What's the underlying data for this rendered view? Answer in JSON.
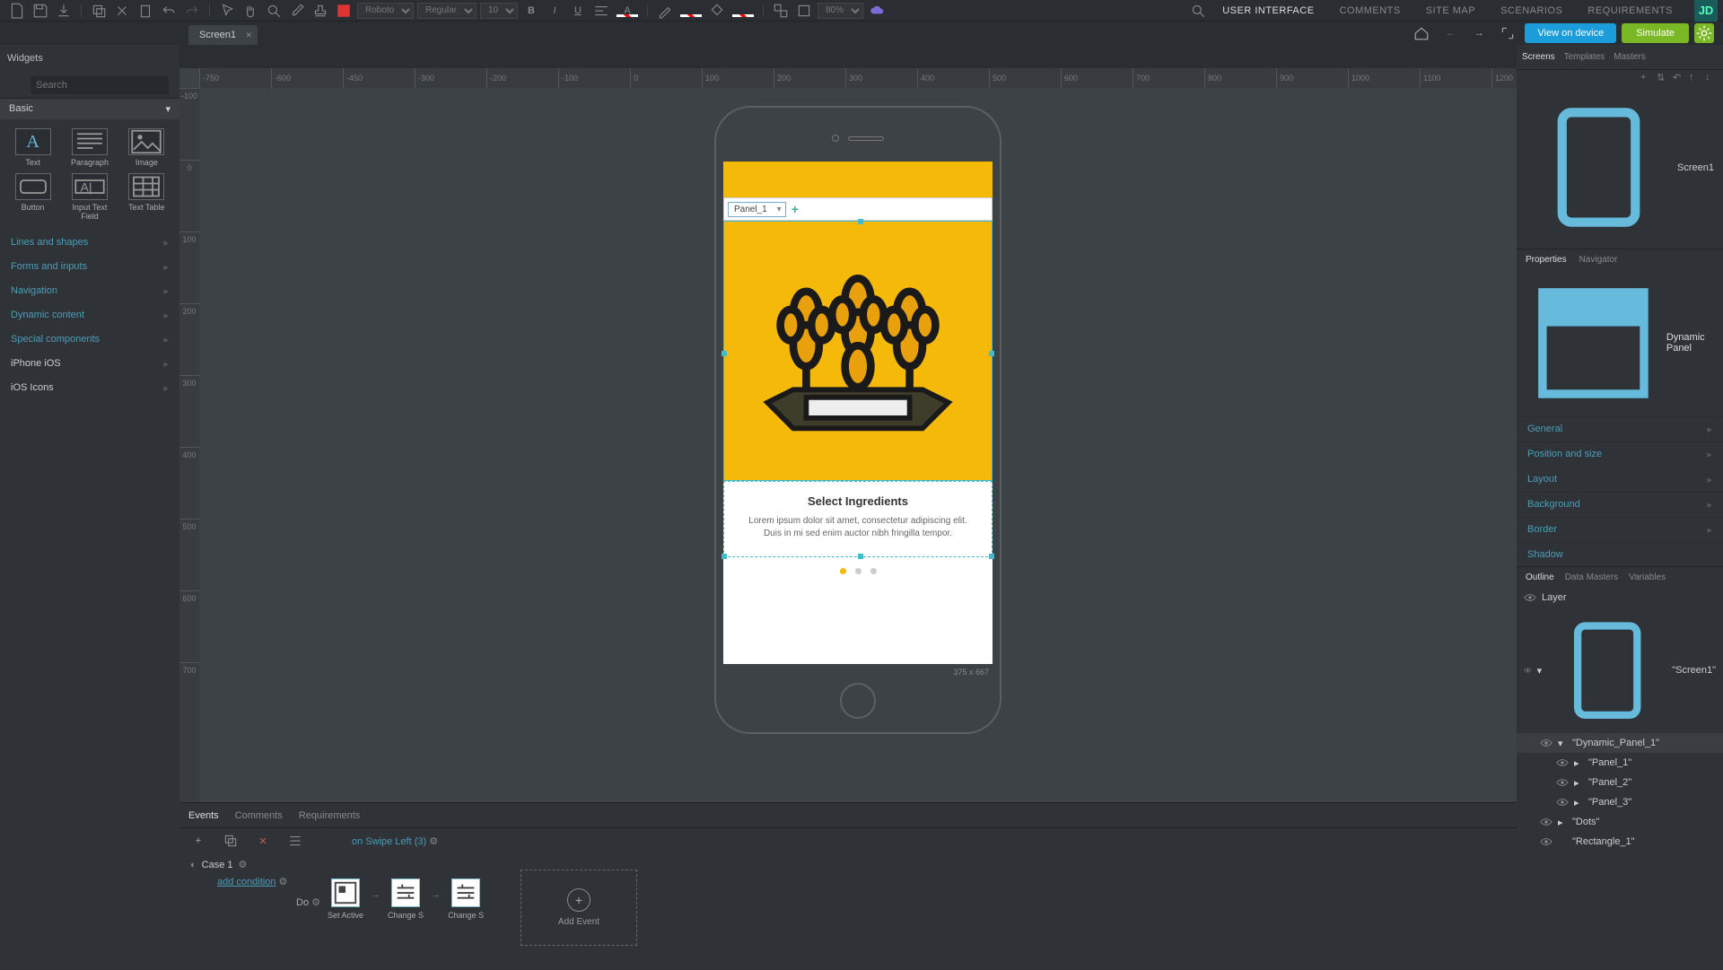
{
  "toolbar": {
    "font": "Roboto",
    "weight": "Regular",
    "size": "10",
    "zoom": "80%"
  },
  "topnav": {
    "ui": "USER INTERFACE",
    "comments": "COMMENTS",
    "sitemap": "SITE MAP",
    "scenarios": "SCENARIOS",
    "requirements": "REQUIREMENTS",
    "avatar": "JD"
  },
  "tabs": {
    "tab1": "Screen1"
  },
  "actions": {
    "view_device": "View on device",
    "simulate": "Simulate"
  },
  "left": {
    "title": "Widgets",
    "search_ph": "Search",
    "basic": "Basic",
    "widgets": {
      "text": "Text",
      "paragraph": "Paragraph",
      "image": "Image",
      "button": "Button",
      "input": "Input Text Field",
      "table": "Text Table"
    },
    "cats": {
      "lines": "Lines and shapes",
      "forms": "Forms and inputs",
      "nav": "Navigation",
      "dynamic": "Dynamic content",
      "special": "Special components",
      "ios": "iPhone iOS",
      "icons": "iOS Icons"
    }
  },
  "right": {
    "tabs": {
      "screens": "Screens",
      "templates": "Templates",
      "masters": "Masters"
    },
    "screen1": "Screen1",
    "props": {
      "tab_props": "Properties",
      "tab_nav": "Navigator",
      "title": "Dynamic Panel",
      "general": "General",
      "pos": "Position and size",
      "layout": "Layout",
      "bg": "Background",
      "border": "Border",
      "shadow": "Shadow"
    },
    "outline": {
      "tab_outline": "Outline",
      "tab_dm": "Data Masters",
      "tab_vars": "Variables",
      "layer": "Layer",
      "screen": "\"Screen1\"",
      "dp": "\"Dynamic_Panel_1\"",
      "p1": "\"Panel_1\"",
      "p2": "\"Panel_2\"",
      "p3": "\"Panel_3\"",
      "dots": "\"Dots\"",
      "rect": "\"Rectangle_1\""
    }
  },
  "canvas": {
    "h_ticks": [
      "-750",
      "-600",
      "-450",
      "-300",
      "-200",
      "-100",
      "0",
      "100",
      "200",
      "300",
      "400",
      "500",
      "600",
      "700",
      "800",
      "900",
      "1000",
      "1100",
      "1200"
    ],
    "v_ticks": [
      "-100",
      "0",
      "100",
      "200",
      "300",
      "400",
      "500",
      "600",
      "700"
    ],
    "panel_dd": "Panel_1",
    "card_title": "Select Ingredients",
    "card_text": "Lorem ipsum dolor sit amet, consectetur adipiscing elit. Duis in mi sed enim auctor nibh fringilla tempor.",
    "size": "375 x 667"
  },
  "bottom": {
    "tabs": {
      "events": "Events",
      "comments": "Comments",
      "req": "Requirements"
    },
    "event": "on Swipe Left (3)",
    "case": "Case 1",
    "cond": "add condition",
    "do": "Do",
    "a1": "Set Active",
    "a2": "Change S",
    "a3": "Change S",
    "add": "Add Event"
  }
}
